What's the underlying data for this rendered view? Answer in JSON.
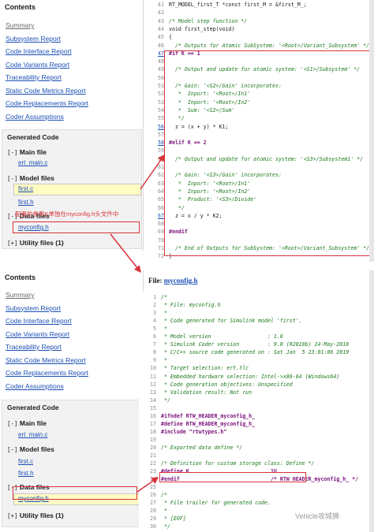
{
  "nav_top": {
    "contents_title": "Contents",
    "links": [
      "Summary",
      "Subsystem Report",
      "Code Interface Report",
      "Code Variants Report",
      "Traceability Report",
      "Static Code Metrics Report",
      "Code Replacements Report",
      "Coder Assumptions"
    ],
    "generated_title": "Generated Code",
    "main_file": "Main file",
    "ert_main": "ert_main.c",
    "model_files": "Model files",
    "first_c": "first.c",
    "first_h": "first.h",
    "data_files": "Data files",
    "myconfig_h": "myconfig.h",
    "utility_files": "Utility files (1)",
    "expander_open": "[-]",
    "expander_closed": "[+]"
  },
  "nav_bottom": {
    "contents_title": "Contents",
    "links": [
      "Summary",
      "Subsystem Report",
      "Code Interface Report",
      "Code Variants Report",
      "Traceability Report",
      "Static Code Metrics Report",
      "Code Replacements Report",
      "Coder Assumptions"
    ],
    "generated_title": "Generated Code",
    "main_file": "Main file",
    "ert_main": "ert_main.c",
    "model_files": "Model files",
    "first_c": "first.c",
    "first_h": "first.h",
    "data_files": "Data files",
    "myconfig_h": "myconfig.h",
    "utility_files": "Utility files (1)",
    "expander_open": "[-]",
    "expander_closed": "[+]"
  },
  "annotation": "配置的参数K单独在myconfig.h头文件中",
  "code_top": [
    {
      "n": "41",
      "text": "RT_MODEL_first_T *const first_M = &first_M_;",
      "cls": "kw"
    },
    {
      "n": "42",
      "text": "",
      "cls": "kw"
    },
    {
      "n": "43",
      "text": "/* Model step function */",
      "cls": "cm"
    },
    {
      "n": "44",
      "text": "void first_step(void)",
      "cls": "kw"
    },
    {
      "n": "45",
      "text": "{",
      "cls": "kw"
    },
    {
      "n": "46",
      "text": "  /* Outputs for Atomic SubSystem: '<Root>/Variant_Subsystem' */",
      "cls": "cm"
    },
    {
      "n": "47",
      "text": "#if K == 1",
      "cls": "pp",
      "link": true
    },
    {
      "n": "48",
      "text": "",
      "cls": "kw"
    },
    {
      "n": "49",
      "text": "  /* Output and update for atomic system: '<S1>/Subsystem' */",
      "cls": "cm"
    },
    {
      "n": "50",
      "text": "",
      "cls": "kw"
    },
    {
      "n": "51",
      "text": "  /* Gain: '<S2>/Gain' incorporates:",
      "cls": "cm"
    },
    {
      "n": "52",
      "text": "   *  Inport: '<Root>/In1'",
      "cls": "cm"
    },
    {
      "n": "53",
      "text": "   *  Inport: '<Root>/In2'",
      "cls": "cm"
    },
    {
      "n": "54",
      "text": "   *  Sum: '<S2>/Sum'",
      "cls": "cm"
    },
    {
      "n": "55",
      "text": "   */",
      "cls": "cm"
    },
    {
      "n": "56",
      "text": "  z = (x + y) * K1;",
      "cls": "kw",
      "link": true
    },
    {
      "n": "57",
      "text": "",
      "cls": "kw"
    },
    {
      "n": "58",
      "text": "#elif K == 2",
      "cls": "pp",
      "link": true
    },
    {
      "n": "59",
      "text": "",
      "cls": "kw"
    },
    {
      "n": "60",
      "text": "  /* Output and update for atomic system: '<S3>/Subsystem1' */",
      "cls": "cm"
    },
    {
      "n": "61",
      "text": "",
      "cls": "kw"
    },
    {
      "n": "62",
      "text": "  /* Gain: '<S3>/Gain' incorporates:",
      "cls": "cm"
    },
    {
      "n": "63",
      "text": "   *  Inport: '<Root>/In1'",
      "cls": "cm"
    },
    {
      "n": "64",
      "text": "   *  Inport: '<Root>/In2'",
      "cls": "cm"
    },
    {
      "n": "65",
      "text": "   *  Product: '<S3>/Divide'",
      "cls": "cm"
    },
    {
      "n": "66",
      "text": "   */",
      "cls": "cm"
    },
    {
      "n": "67",
      "text": "  z = x / y * K2;",
      "cls": "kw",
      "link": true
    },
    {
      "n": "68",
      "text": "",
      "cls": "kw"
    },
    {
      "n": "69",
      "text": "#endif",
      "cls": "pp"
    },
    {
      "n": "70",
      "text": "",
      "cls": "kw"
    },
    {
      "n": "71",
      "text": "  /* End of Outputs for SubSystem: '<Root>/Variant_Subsystem' */",
      "cls": "cm"
    },
    {
      "n": "72",
      "text": "}",
      "cls": "kw"
    }
  ],
  "file_header_label": "File:",
  "file_header_name": "myconfig.h",
  "code_bottom": [
    {
      "n": "1",
      "text": "/*",
      "cls": "cm"
    },
    {
      "n": "2",
      "text": " * File: myconfig.h",
      "cls": "cm"
    },
    {
      "n": "3",
      "text": " *",
      "cls": "cm"
    },
    {
      "n": "4",
      "text": " * Code generated for Simulink model 'first'.",
      "cls": "cm"
    },
    {
      "n": "5",
      "text": " *",
      "cls": "cm"
    },
    {
      "n": "6",
      "text": " * Model version                  : 1.6",
      "cls": "cm"
    },
    {
      "n": "7",
      "text": " * Simulink Coder version         : 9.0 (R2018b) 24-May-2018",
      "cls": "cm"
    },
    {
      "n": "8",
      "text": " * C/C++ source code generated on : Sat Jan  5 23:01:06 2019",
      "cls": "cm"
    },
    {
      "n": "9",
      "text": " *",
      "cls": "cm"
    },
    {
      "n": "10",
      "text": " * Target selection: ert.tlc",
      "cls": "cm"
    },
    {
      "n": "11",
      "text": " * Embedded hardware selection: Intel->x86-64 (Windows64)",
      "cls": "cm"
    },
    {
      "n": "12",
      "text": " * Code generation objectives: Unspecified",
      "cls": "cm"
    },
    {
      "n": "13",
      "text": " * Validation result: Not run",
      "cls": "cm"
    },
    {
      "n": "14",
      "text": " */",
      "cls": "cm"
    },
    {
      "n": "15",
      "text": "",
      "cls": "kw"
    },
    {
      "n": "16",
      "text": "#ifndef RTW_HEADER_myconfig_h_",
      "cls": "pp"
    },
    {
      "n": "17",
      "text": "#define RTW_HEADER_myconfig_h_",
      "cls": "pp"
    },
    {
      "n": "18",
      "text": "#include \"rtwtypes.h\"",
      "cls": "pp"
    },
    {
      "n": "19",
      "text": "",
      "cls": "kw"
    },
    {
      "n": "20",
      "text": "/* Exported data define */",
      "cls": "cm"
    },
    {
      "n": "21",
      "text": "",
      "cls": "kw"
    },
    {
      "n": "22",
      "text": "/* Definition for custom storage class: Define */",
      "cls": "cm"
    },
    {
      "n": "23",
      "text": "#define K                          1U",
      "cls": "pp"
    },
    {
      "n": "24",
      "text": "#endif                             /* RTW_HEADER_myconfig_h_ */",
      "cls": "pp"
    },
    {
      "n": "25",
      "text": "",
      "cls": "kw"
    },
    {
      "n": "26",
      "text": "/*",
      "cls": "cm"
    },
    {
      "n": "27",
      "text": " * File trailer for generated code.",
      "cls": "cm"
    },
    {
      "n": "28",
      "text": " *",
      "cls": "cm"
    },
    {
      "n": "29",
      "text": " * [EOF]",
      "cls": "cm"
    },
    {
      "n": "30",
      "text": " */",
      "cls": "cm"
    }
  ],
  "watermark": "Vehicle攻城狮",
  "colors": {
    "accent_red": "#d9323a",
    "link_blue": "#1b4fb5",
    "highlight": "#fffcc4",
    "comment_green": "#1d7a1d"
  }
}
